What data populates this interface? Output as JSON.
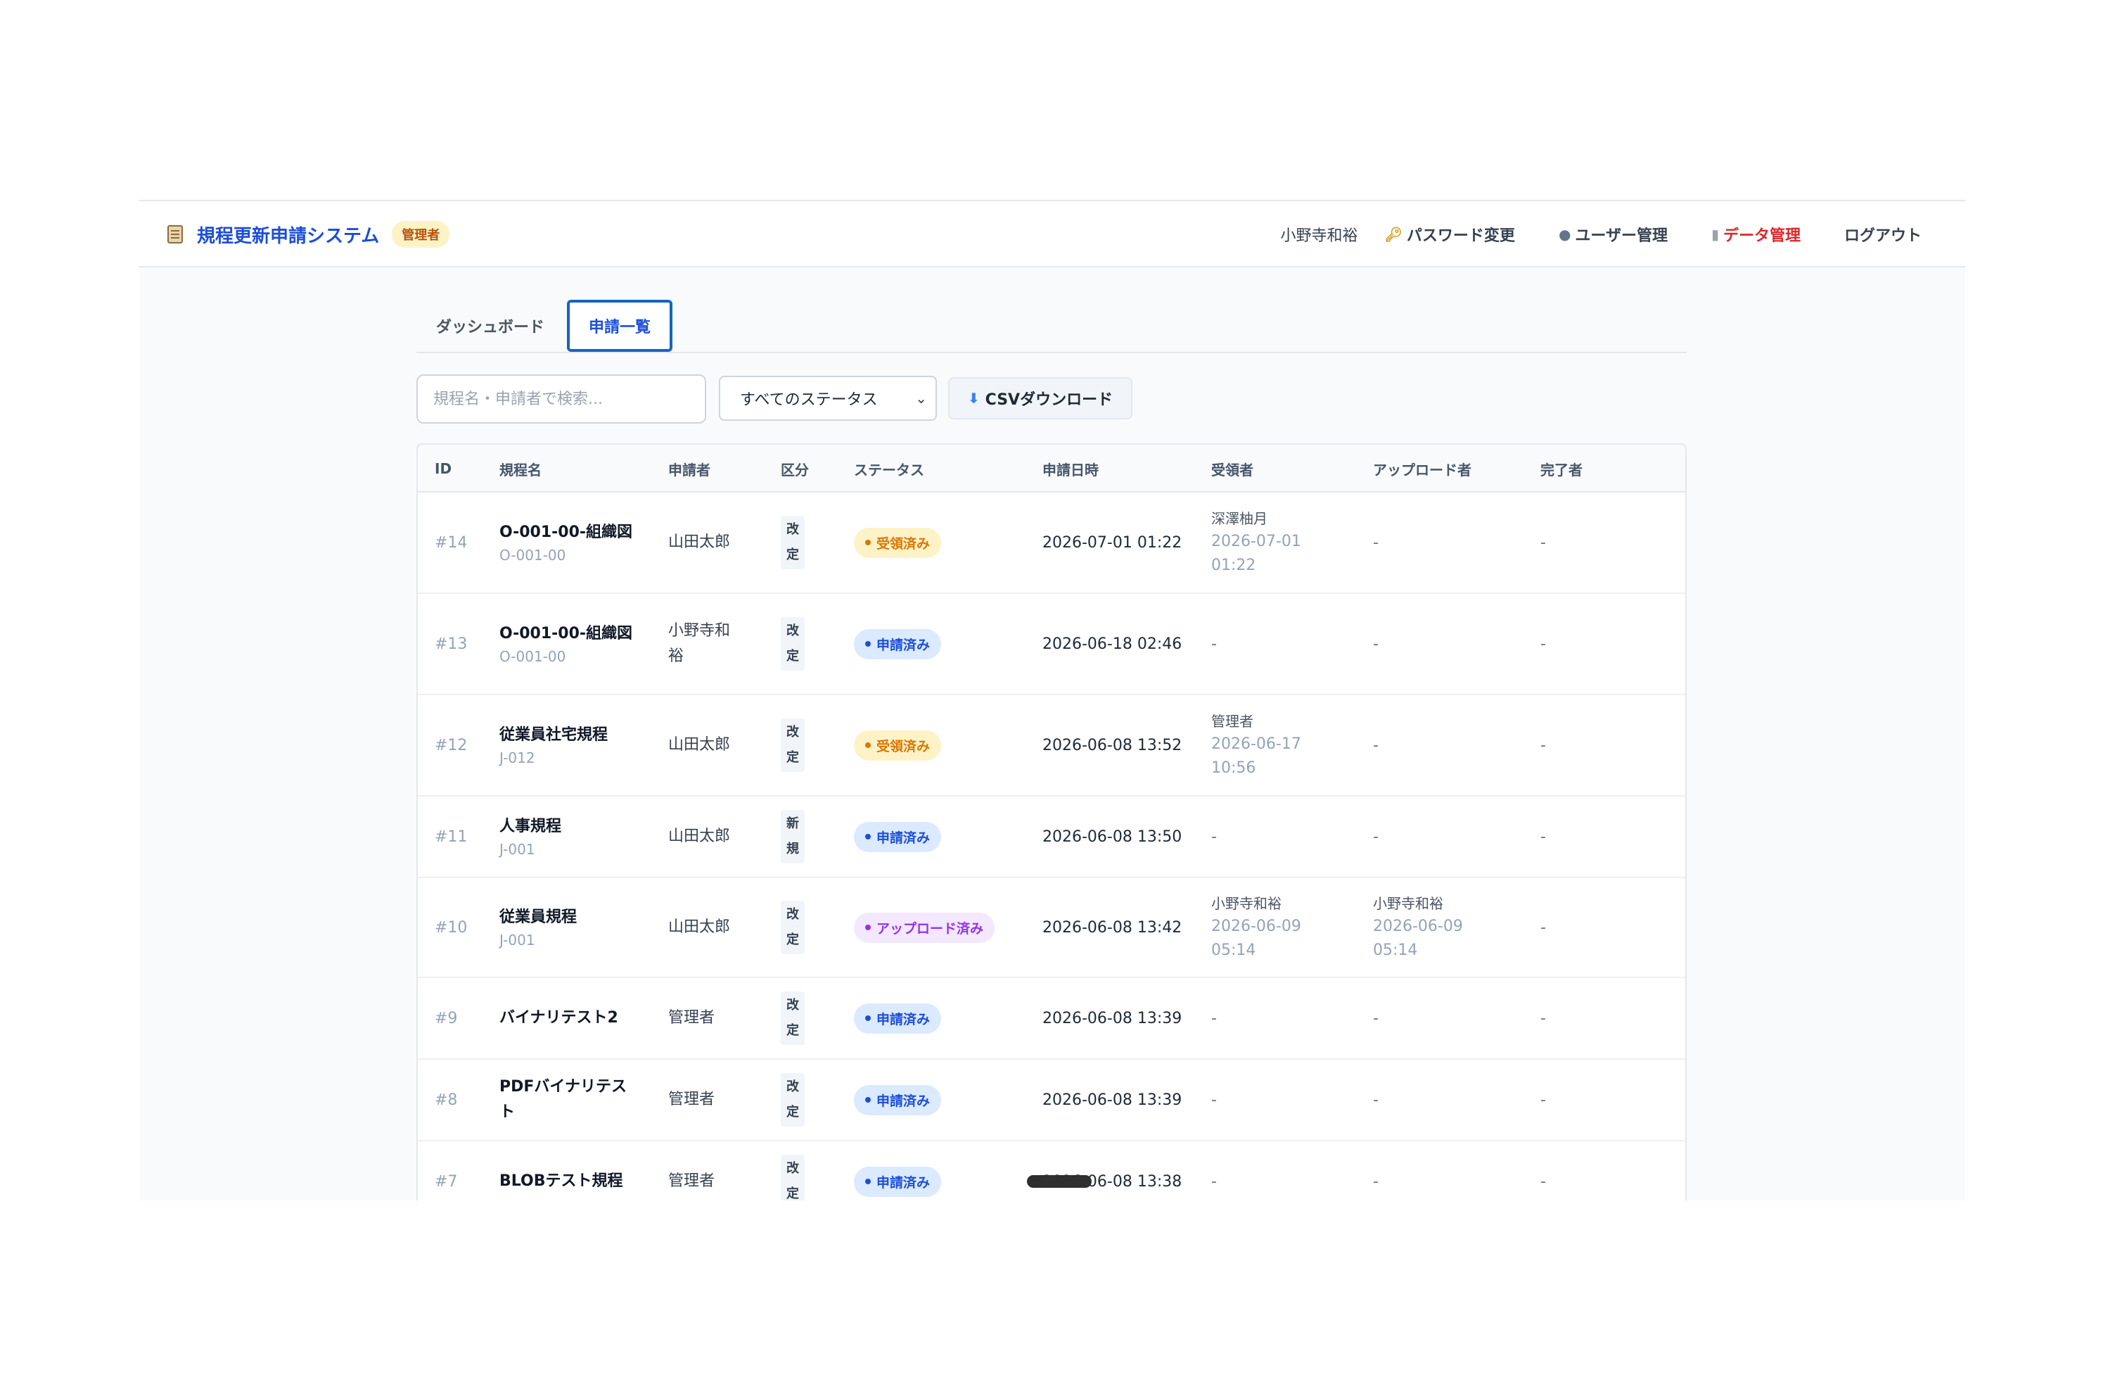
{
  "header": {
    "app_title": "規程更新申請システム",
    "role_badge": "管理者",
    "user_name": "小野寺和裕",
    "links": {
      "password": "パスワード変更",
      "users": "ユーザー管理",
      "data": "データ管理",
      "logout": "ログアウト"
    }
  },
  "tabs": {
    "dashboard": "ダッシュボード",
    "list": "申請一覧"
  },
  "toolbar": {
    "search_placeholder": "規程名・申請者で検索...",
    "status_select": "すべてのステータス",
    "csv_button": "CSVダウンロード"
  },
  "table": {
    "headers": {
      "id": "ID",
      "name": "規程名",
      "applicant": "申請者",
      "kind": "区分",
      "status": "ステータス",
      "date": "申請日時",
      "receiver": "受領者",
      "uploader": "アップロード者",
      "completer": "完了者"
    },
    "rows": [
      {
        "id": "#14",
        "name": "O-001-00-組織図",
        "code": "O-001-00",
        "applicant": "山田太郎",
        "kind": "改定",
        "status": "受領済み",
        "date": "2026-07-01 01:22",
        "receiver_name": "深澤柚月",
        "receiver_date": "2026-07-01 01:22",
        "uploader": "-",
        "completer": "-"
      },
      {
        "id": "#13",
        "name": "O-001-00-組織図",
        "code": "O-001-00",
        "applicant": "小野寺和裕",
        "kind": "改定",
        "status": "申請済み",
        "date": "2026-06-18 02:46",
        "receiver": "-",
        "uploader": "-",
        "completer": "-"
      },
      {
        "id": "#12",
        "name": "従業員社宅規程",
        "code": "J-012",
        "applicant": "山田太郎",
        "kind": "改定",
        "status": "受領済み",
        "date": "2026-06-08 13:52",
        "receiver_name": "管理者",
        "receiver_date": "2026-06-17 10:56",
        "uploader": "-",
        "completer": "-"
      },
      {
        "id": "#11",
        "name": "人事規程",
        "code": "J-001",
        "applicant": "山田太郎",
        "kind": "新規",
        "status": "申請済み",
        "date": "2026-06-08 13:50",
        "receiver": "-",
        "uploader": "-",
        "completer": "-"
      },
      {
        "id": "#10",
        "name": "従業員規程",
        "code": "J-001",
        "applicant": "山田太郎",
        "kind": "改定",
        "status": "アップロード済み",
        "date": "2026-06-08 13:42",
        "receiver_name": "小野寺和裕",
        "receiver_date": "2026-06-09 05:14",
        "uploader_name": "小野寺和裕",
        "uploader_date": "2026-06-09 05:14",
        "completer": "-"
      },
      {
        "id": "#9",
        "name": "バイナリテスト2",
        "applicant": "管理者",
        "kind": "改定",
        "status": "申請済み",
        "date": "2026-06-08 13:39",
        "receiver": "-",
        "uploader": "-",
        "completer": "-"
      },
      {
        "id": "#8",
        "name": "PDFバイナリテスト",
        "applicant": "管理者",
        "kind": "改定",
        "status": "申請済み",
        "date": "2026-06-08 13:39",
        "receiver": "-",
        "uploader": "-",
        "completer": "-"
      },
      {
        "id": "#7",
        "name": "BLOBテスト規程",
        "applicant": "管理者",
        "kind": "改定",
        "status": "申請済み",
        "date": "2026-06-08 13:38",
        "receiver": "-",
        "uploader": "-",
        "completer": "-"
      }
    ]
  },
  "colors": {
    "brand": "#1d4ed8",
    "received": "#d97706",
    "applied": "#1d4ed8",
    "uploaded": "#9333ea",
    "danger": "#dc2626"
  }
}
